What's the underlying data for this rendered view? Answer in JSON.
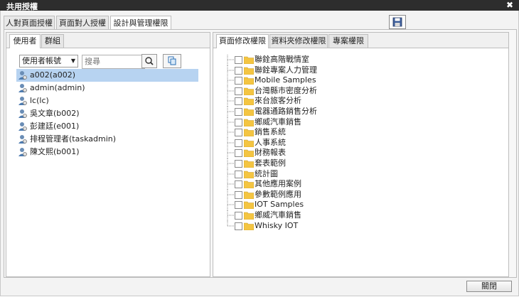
{
  "window": {
    "title": "共用授權",
    "close_symbol": "✖"
  },
  "top_tabs": [
    {
      "label": "人對頁面授權",
      "active": false
    },
    {
      "label": "頁面對人授權",
      "active": false
    },
    {
      "label": "設計與管理權限",
      "active": true
    }
  ],
  "left": {
    "tabs": [
      {
        "label": "使用者",
        "active": true
      },
      {
        "label": "群組",
        "active": false
      }
    ],
    "filter_select": "使用者帳號",
    "search": {
      "placeholder": "搜尋",
      "value": ""
    },
    "users": [
      {
        "label": "a002(a002)",
        "selected": true
      },
      {
        "label": "admin(admin)",
        "selected": false
      },
      {
        "label": "lc(lc)",
        "selected": false
      },
      {
        "label": "吳文章(b002)",
        "selected": false
      },
      {
        "label": "彭建廷(e001)",
        "selected": false
      },
      {
        "label": "排程管理者(taskadmin)",
        "selected": false
      },
      {
        "label": "陳文熙(b001)",
        "selected": false
      }
    ]
  },
  "right": {
    "tabs": [
      {
        "label": "頁面修改權限",
        "active": true
      },
      {
        "label": "資料夾修改權限",
        "active": false
      },
      {
        "label": "專案權限",
        "active": false
      }
    ],
    "tree": [
      {
        "label": "聯銓高階戰情室",
        "checked": false
      },
      {
        "label": "聯銓專案人力管理",
        "checked": false
      },
      {
        "label": "Mobile Samples",
        "checked": false
      },
      {
        "label": "台灣縣市密度分析",
        "checked": false
      },
      {
        "label": "來台旅客分析",
        "checked": false
      },
      {
        "label": "電器通路銷售分析",
        "checked": false
      },
      {
        "label": "鄉威汽車銷售",
        "checked": false
      },
      {
        "label": "銷售系統",
        "checked": false
      },
      {
        "label": "人事系統",
        "checked": false
      },
      {
        "label": "財務報表",
        "checked": false
      },
      {
        "label": "套表範例",
        "checked": false
      },
      {
        "label": "統計圖",
        "checked": false
      },
      {
        "label": "其他應用案例",
        "checked": false
      },
      {
        "label": "參數範例應用",
        "checked": false
      },
      {
        "label": "IOT Samples",
        "checked": false
      },
      {
        "label": "鄉威汽車銷售",
        "checked": false
      },
      {
        "label": "Whisky IOT",
        "checked": false
      }
    ]
  },
  "footer": {
    "close_label": "關閉"
  },
  "colors": {
    "titlebar": "#2d2d2d",
    "selected_row": "#b7d3f1",
    "folder": "#f4c542"
  }
}
